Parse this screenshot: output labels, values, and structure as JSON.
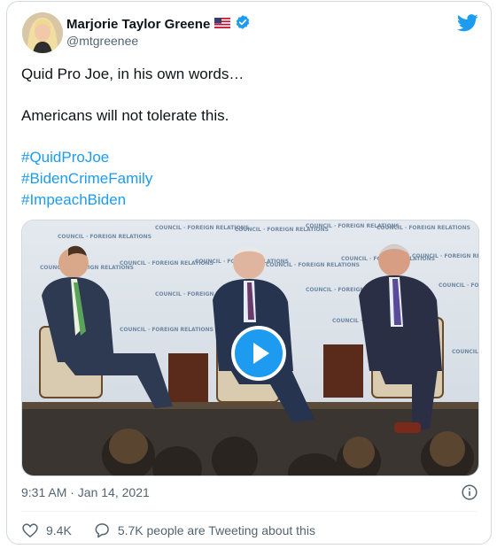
{
  "author": {
    "name": "Marjorie Taylor Greene",
    "flag_icon": "us-flag-icon",
    "verified_icon": "verified-badge-icon",
    "handle": "@mtgreenee"
  },
  "brand": {
    "logo_icon": "twitter-bird-icon",
    "color": "#1d9bf0"
  },
  "tweet": {
    "line1": "Quid Pro Joe, in his own words…",
    "line2": "Americans will not tolerate this.",
    "hashtags": [
      "#QuidProJoe",
      "#BidenCrimeFamily",
      "#ImpeachBiden"
    ]
  },
  "media": {
    "play_icon": "play-icon",
    "backdrop_text": "COUNCIL on FOREIGN RELATIONS"
  },
  "meta": {
    "timestamp": "9:31 AM · Jan 14, 2021",
    "info_icon": "info-icon"
  },
  "actions": {
    "likes": "9.4K",
    "conversation": "5.7K people are Tweeting about this"
  },
  "colors": {
    "text_primary": "#0f1419",
    "text_secondary": "#536471",
    "link": "#1d9bf0",
    "border": "#cfd9de"
  }
}
